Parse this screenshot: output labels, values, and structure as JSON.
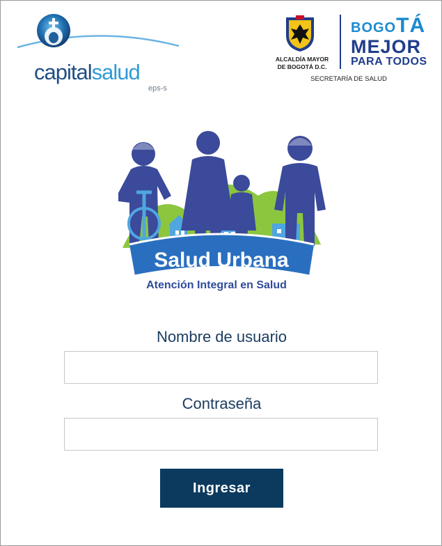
{
  "header": {
    "capitalsalud": {
      "word_part1": "capital",
      "word_part2": "salud",
      "suffix": "eps-s"
    },
    "bogota": {
      "alcaldia_line1": "ALCALDÍA MAYOR",
      "alcaldia_line2": "DE BOGOTÁ D.C.",
      "brand_line1_prefix": "BO",
      "brand_line1_small": "GO",
      "brand_line1_suffix": "TÁ",
      "brand_line2": "MEJOR",
      "brand_line3": "PARA TODOS",
      "secretaria": "SECRETARÍA DE SALUD"
    }
  },
  "illustration": {
    "banner_title": "Salud Urbana",
    "banner_subtitle": "Atención Integral en Salud",
    "colors": {
      "figure": "#3b4a9a",
      "banner": "#2a6fbf",
      "hills": "#8cc63f",
      "buildings": "#4fa6e0"
    }
  },
  "form": {
    "username_label": "Nombre de usuario",
    "username_value": "",
    "password_label": "Contraseña",
    "password_value": "",
    "submit_label": "Ingresar"
  },
  "colors": {
    "label_text": "#1c3d61",
    "button_bg": "#0b3a5e",
    "button_text": "#ffffff"
  }
}
